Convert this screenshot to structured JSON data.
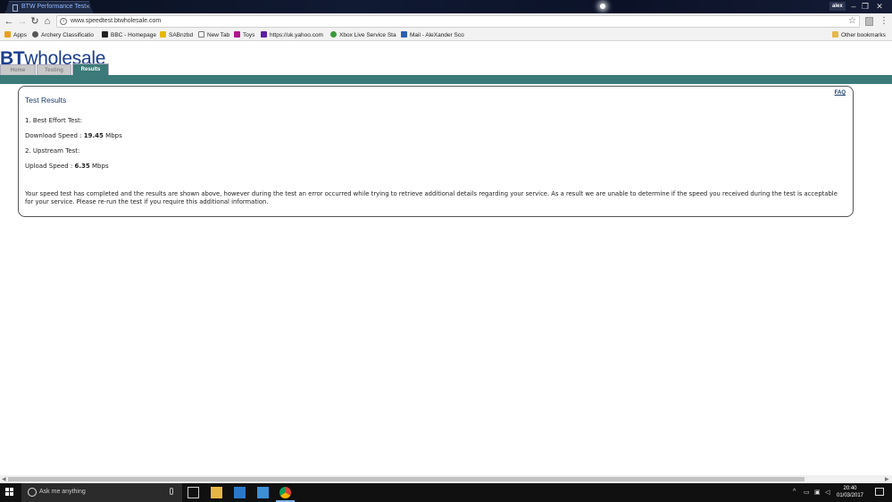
{
  "browser": {
    "tab_title": "BTW Performance Test",
    "tab_close": "×",
    "window_user": "alex",
    "url": "www.speedtest.btwholesale.com",
    "bookmarks": [
      {
        "label": "Apps",
        "color": "#e8a020"
      },
      {
        "label": "Archery Classificatio",
        "color": "#555555"
      },
      {
        "label": "BBC - Homepage",
        "color": "#222222"
      },
      {
        "label": "SABnzbd",
        "color": "#e6b800"
      },
      {
        "label": "New Tab",
        "color": "#dddddd"
      },
      {
        "label": "Toys",
        "color": "#b0178e"
      },
      {
        "label": "https://uk.yahoo.com",
        "color": "#5c1fa3"
      },
      {
        "label": "Xbox Live Service Sta",
        "color": "#3a9a3a"
      },
      {
        "label": "Mail - AleXander Sco",
        "color": "#2a5fb0"
      }
    ],
    "other_bookmarks": "Other bookmarks"
  },
  "site": {
    "logo_bt": "BT",
    "logo_rest": "wholesale",
    "tabs": [
      "Home",
      "Testing",
      "Results"
    ],
    "active_tab": "Results",
    "brand_color": "#3b7a78"
  },
  "results": {
    "title": "Test Results",
    "faq": "FAQ",
    "section1": "1. Best Effort Test:",
    "download_label": "Download Speed : ",
    "download_value": "19.45",
    "download_unit": " Mbps",
    "section2": "2. Upstream Test:",
    "upload_label": "Upload Speed : ",
    "upload_value": "6.35",
    "upload_unit": " Mbps",
    "message": "Your speed test has completed and the results are shown above, however during the test an error occurred while trying to retrieve additional details regarding your service. As a result we are unable to determine if the speed you received during the test is acceptable for your service. Please re-run the test if you require this additional information."
  },
  "taskbar": {
    "search_placeholder": "Ask me anything",
    "time": "20:40",
    "date": "01/03/2017"
  }
}
